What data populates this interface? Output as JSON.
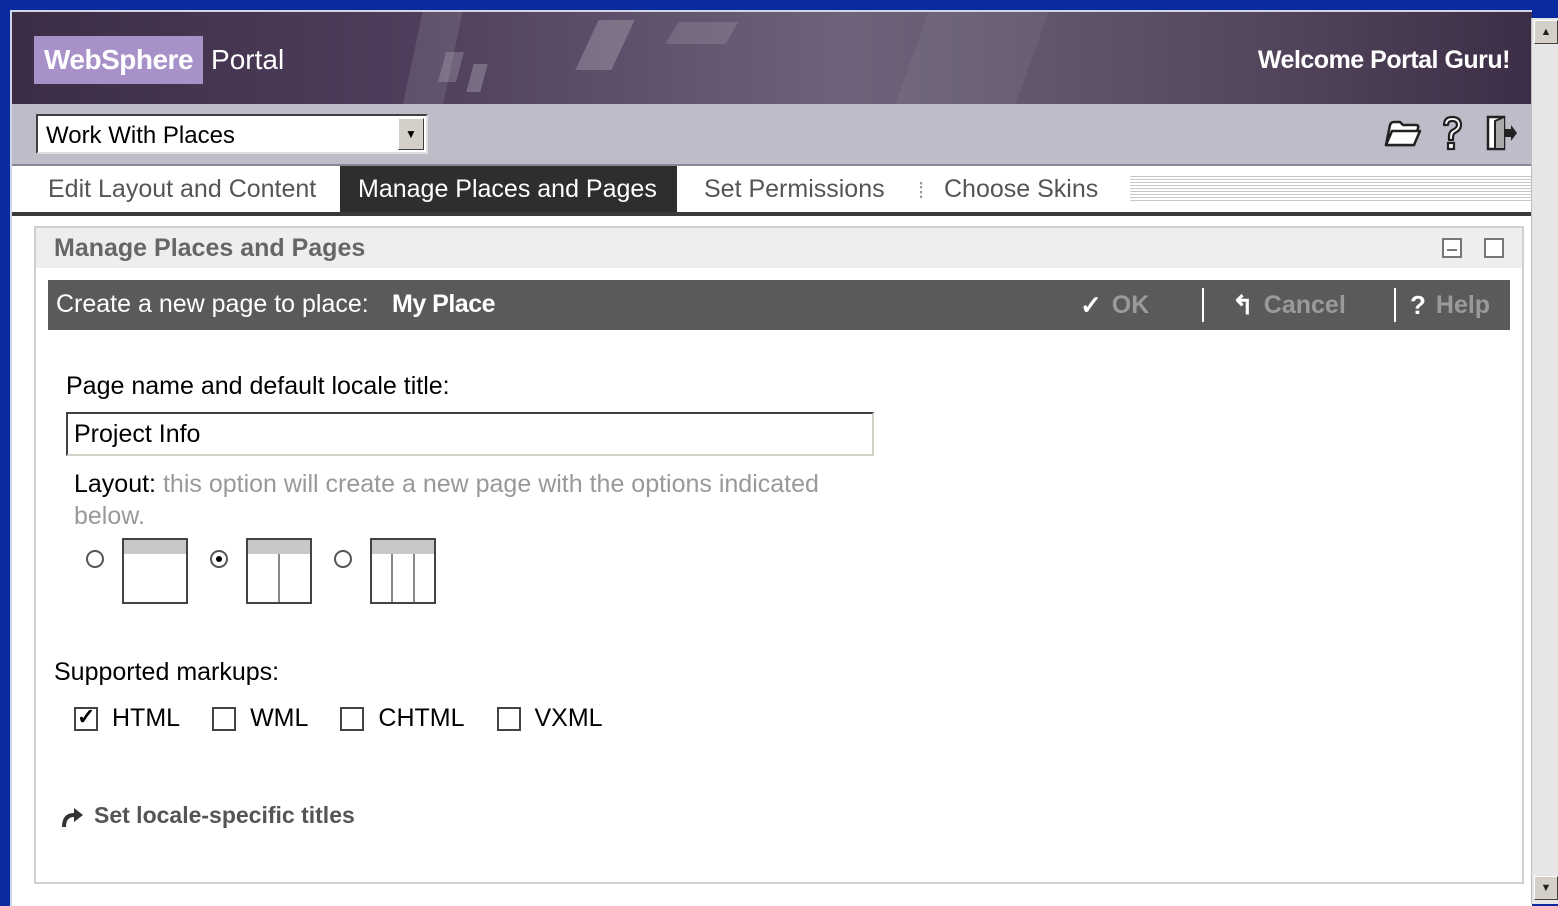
{
  "banner": {
    "logo_brand": "WebSphere",
    "logo_product": "Portal",
    "welcome": "Welcome Portal Guru!"
  },
  "toolbar": {
    "place_select_value": "Work With Places",
    "icons": [
      "folder-open-icon",
      "help-icon",
      "logout-icon"
    ]
  },
  "tabs": [
    {
      "label": "Edit Layout and Content",
      "active": false
    },
    {
      "label": "Manage Places and Pages",
      "active": true
    },
    {
      "label": "Set Permissions",
      "active": false
    },
    {
      "label": "Choose Skins",
      "active": false
    }
  ],
  "tab_separator": "⁞",
  "portlet": {
    "title": "Manage Places and Pages",
    "action_bar": {
      "label": "Create a new page to place:",
      "place": "My Place",
      "ok": "OK",
      "cancel": "Cancel",
      "help": "Help"
    },
    "page_name_label": "Page name and default locale title:",
    "page_name_value": "Project Info",
    "layout_label": "Layout:",
    "layout_desc": "this option will create a new page with the options indicated below.",
    "layouts": [
      {
        "columns": 1,
        "selected": false
      },
      {
        "columns": 2,
        "selected": true
      },
      {
        "columns": 3,
        "selected": false
      }
    ],
    "markups_label": "Supported markups:",
    "markups": [
      {
        "label": "HTML",
        "checked": true
      },
      {
        "label": "WML",
        "checked": false
      },
      {
        "label": "CHTML",
        "checked": false
      },
      {
        "label": "VXML",
        "checked": false
      }
    ],
    "locale_link": "Set locale-specific titles"
  },
  "colors": {
    "desktop": "#0a2aa0",
    "banner": "#4e3d5a",
    "logo_badge": "#a890c8",
    "action_bar": "#5a5a5a"
  }
}
